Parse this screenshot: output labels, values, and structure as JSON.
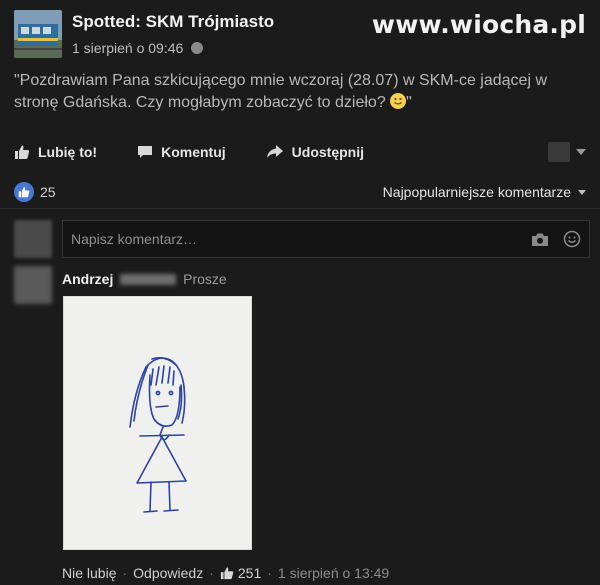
{
  "watermark": "www.wiocha.pl",
  "post": {
    "page_name": "Spotted: SKM Trójmiasto",
    "timestamp": "1 sierpień o 09:46",
    "text": "\"Pozdrawiam Pana szkicującego mnie wczoraj (28.07) w SKM-ce jadącej w stronę Gdańska. Czy mogłabym zobaczyć to dzieło? ",
    "text_end": "\""
  },
  "actions": {
    "like": "Lubię to!",
    "comment": "Komentuj",
    "share": "Udostępnij"
  },
  "reactions": {
    "count": "25",
    "sort": "Najpopularniejsze komentarze"
  },
  "composer": {
    "placeholder": "Napisz komentarz…"
  },
  "comment": {
    "author": "Andrzej",
    "text": "Prosze",
    "footer": {
      "unlike": "Nie lubię",
      "reply": "Odpowiedz",
      "likes": "251",
      "time": "1 sierpień o 13:49"
    }
  },
  "colors": {
    "background": "#1b1b1b",
    "accent_like": "#4a76d4",
    "paper": "#f0f0ee",
    "ink": "#2b43a6"
  }
}
